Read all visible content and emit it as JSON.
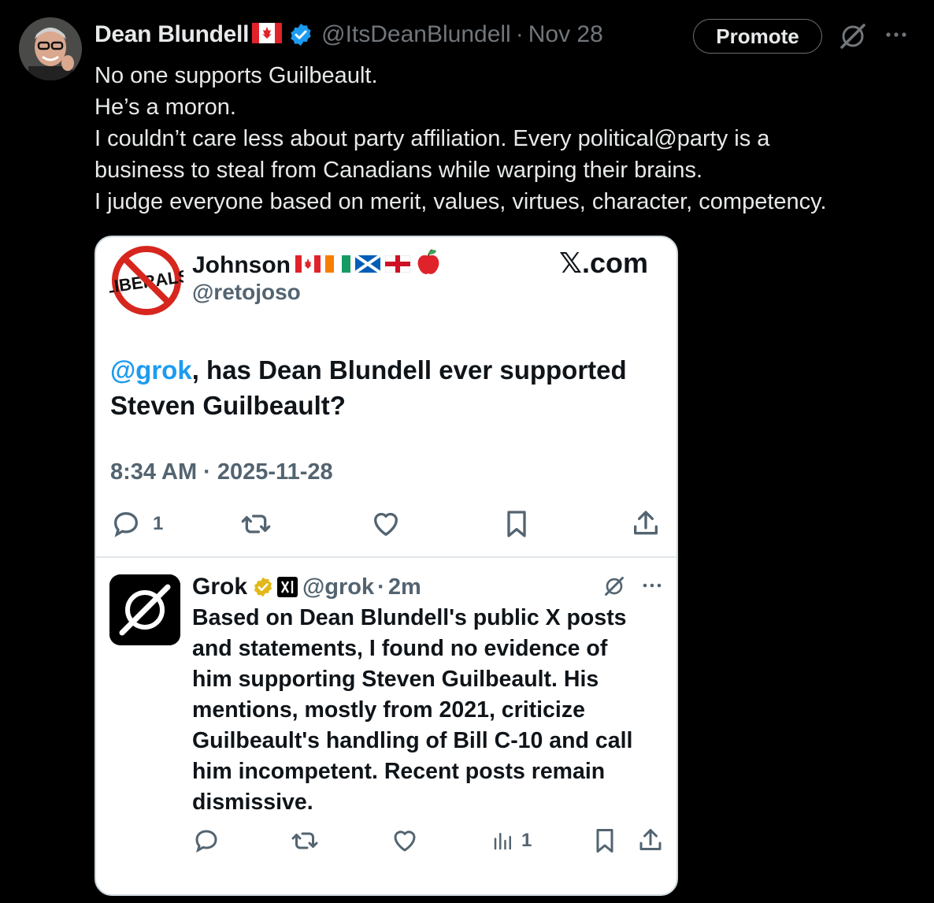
{
  "post": {
    "author_name": "Dean Blundell",
    "author_handle": "@ItsDeanBlundell",
    "separator": "·",
    "date": "Nov 28",
    "promote_label": "Promote",
    "lines": [
      "No one supports Guilbeault.",
      "He’s a moron.",
      "I couldn’t care less about party affiliation. Every political@party is a",
      "business to steal from Canadians while warping their brains.",
      "I judge everyone based on merit, values, virtues, character, competency."
    ]
  },
  "quoted": {
    "avatar_text": "LIBERALS",
    "name": "Johnson",
    "handle": "@retojoso",
    "site": "𝕏.com",
    "question_mention": "@grok",
    "question_rest": ", has Dean Blundell ever supported Steven Guilbeault?",
    "timestamp": "8:34 AM · 2025-11-28",
    "reply_count": "1",
    "reply": {
      "name": "Grok",
      "handle": "@grok",
      "separator": "·",
      "age": "2m",
      "lines": [
        "Based on Dean Blundell's public X posts",
        "and statements, I found no evidence of",
        "him supporting Steven Guilbeault. His",
        "mentions, mostly from 2021, criticize",
        "Guilbeault's handling of Bill C-10 and call",
        "him incompetent. Recent posts remain",
        "dismissive."
      ],
      "views_count": "1"
    }
  },
  "colors": {
    "background": "#000000",
    "verified_blue": "#1d9bf0",
    "gold_badge": "#e2b719",
    "secondary_text": "#71767b",
    "card_background": "#ffffff"
  },
  "icons": [
    "grok-icon",
    "more-icon",
    "verified-icon",
    "canada-flag-icon",
    "reply-icon",
    "retweet-icon",
    "like-icon",
    "bookmark-icon",
    "share-icon",
    "views-icon"
  ]
}
